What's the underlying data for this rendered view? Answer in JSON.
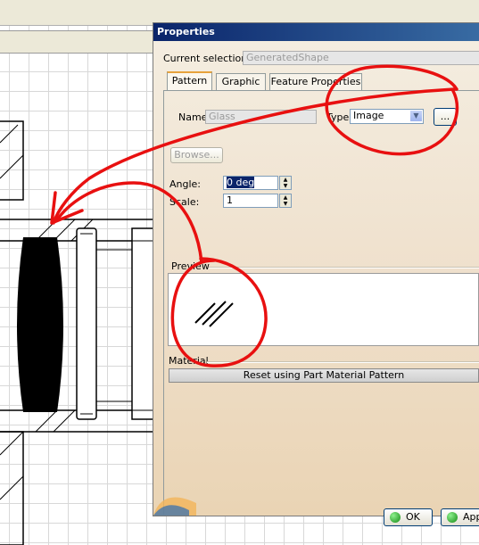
{
  "dialog": {
    "title": "Properties",
    "current_selection_label": "Current selection :",
    "current_selection_value": "GeneratedShape",
    "tabs": [
      {
        "label": "Pattern",
        "active": true
      },
      {
        "label": "Graphic",
        "active": false
      },
      {
        "label": "Feature Properties",
        "active": false
      }
    ],
    "name_label": "Name:",
    "name_value": "Glass",
    "type_label": "Type:",
    "type_value": "Image",
    "more_button": "...",
    "browse_button": "Browse...",
    "angle_label": "Angle:",
    "angle_value": "0 deg",
    "scale_label": "Scale:",
    "scale_value": "1",
    "preview_label": "Preview",
    "material_label": "Material",
    "reset_button": "Reset using Part Material Pattern",
    "ok_button": "OK",
    "apply_button": "Apply"
  },
  "annotations": {
    "color": "#e81010"
  }
}
